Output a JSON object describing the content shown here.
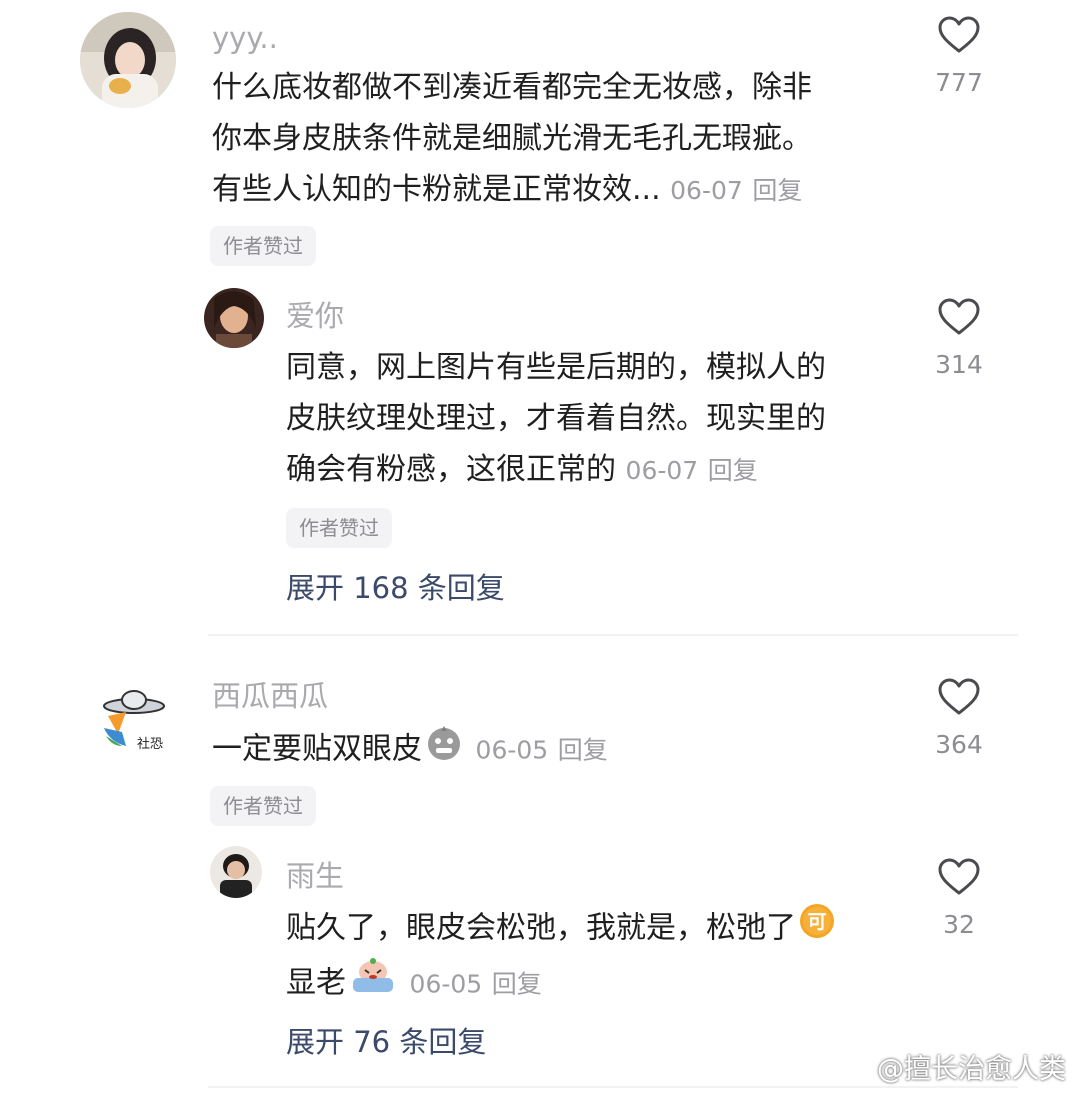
{
  "comments": [
    {
      "username": "yyy..",
      "lines": [
        "什么底妆都做不到凑近看都完全无妆感，除非",
        "你本身皮肤条件就是细腻光滑无毛孔无瑕疵。",
        "有些人认知的卡粉就是正常妆效..."
      ],
      "date": "06-07",
      "reply_label": "回复",
      "badge": "作者赞过",
      "likes": "777",
      "replies": [
        {
          "username": "爱你",
          "lines": [
            "同意，网上图片有些是后期的，模拟人的",
            "皮肤纹理处理过，才看着自然。现实里的",
            "确会有粉感，这很正常的"
          ],
          "date": "06-07",
          "reply_label": "回复",
          "badge": "作者赞过",
          "likes": "314"
        }
      ],
      "expand_label": "展开 168 条回复"
    },
    {
      "username": "西瓜西瓜",
      "lines": [
        "一定要贴双眼皮"
      ],
      "date": "06-05",
      "reply_label": "回复",
      "badge": "作者赞过",
      "likes": "364",
      "avatar_text": "社恐",
      "replies": [
        {
          "username": "雨生",
          "lines": [
            "贴久了，眼皮会松弛，我就是，松弛了",
            "显老"
          ],
          "date": "06-05",
          "reply_label": "回复",
          "likes": "32",
          "emoji_text": "可"
        }
      ],
      "expand_label": "展开 76 条回复"
    }
  ],
  "watermark": "@擅长治愈人类",
  "icons": {
    "heart": "heart-outline-icon",
    "weibo": "weibo-logo-icon"
  },
  "colors": {
    "username": "#a9a9ae",
    "text": "#1f1f1f",
    "meta": "#9d9da3",
    "expand": "#3b4a6b",
    "badge_bg": "#f3f3f5"
  }
}
